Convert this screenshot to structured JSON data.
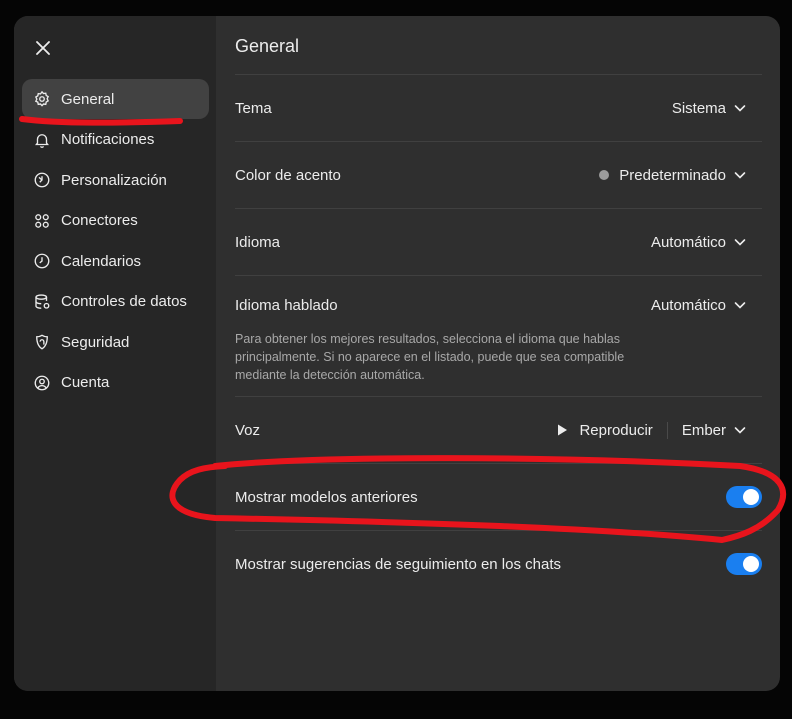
{
  "sidebar": {
    "items": [
      {
        "label": "General",
        "icon": "gear-icon",
        "active": true
      },
      {
        "label": "Notificaciones",
        "icon": "bell-icon"
      },
      {
        "label": "Personalización",
        "icon": "personalization-icon"
      },
      {
        "label": "Conectores",
        "icon": "connectors-icon"
      },
      {
        "label": "Calendarios",
        "icon": "clock-icon"
      },
      {
        "label": "Controles de datos",
        "icon": "database-icon"
      },
      {
        "label": "Seguridad",
        "icon": "shield-icon"
      },
      {
        "label": "Cuenta",
        "icon": "account-icon"
      }
    ]
  },
  "main": {
    "title": "General",
    "theme": {
      "label": "Tema",
      "value": "Sistema"
    },
    "accent": {
      "label": "Color de acento",
      "value": "Predeterminado",
      "dot_color": "#9b9b9b"
    },
    "language": {
      "label": "Idioma",
      "value": "Automático"
    },
    "spoken_language": {
      "label": "Idioma hablado",
      "value": "Automático",
      "hint": "Para obtener los mejores resultados, selecciona el idioma que hablas principalmente. Si no aparece en el listado, puede que sea compatible mediante la detección automática."
    },
    "voice": {
      "label": "Voz",
      "play_label": "Reproducir",
      "value": "Ember"
    },
    "legacy_models": {
      "label": "Mostrar modelos anteriores",
      "enabled": true
    },
    "follow_up": {
      "label": "Mostrar sugerencias de seguimiento en los chats",
      "enabled": true
    }
  },
  "colors": {
    "toggle_on": "#1a7ff0",
    "annotation": "#e8141c"
  }
}
